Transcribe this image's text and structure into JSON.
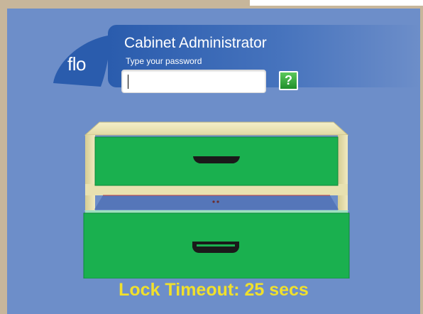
{
  "logo": {
    "text": "flo",
    "icon": "flo-logo-icon",
    "color": "#2a5cad"
  },
  "login": {
    "title": "Cabinet Administrator",
    "subtitle": "Type your password",
    "password_value": "",
    "help_label": "?"
  },
  "cabinet": {
    "icon": "filing-cabinet-icon",
    "drawer_color": "#1ab04f",
    "frame_color": "#ece6b5",
    "handle_color": "#1a1a1a",
    "drawers": [
      {
        "name": "top-drawer",
        "state": "closed"
      },
      {
        "name": "bottom-drawer",
        "state": "open"
      }
    ]
  },
  "status": {
    "lock_timeout": "Lock Timeout: 25 secs"
  },
  "colors": {
    "background": "#6d8ec9",
    "frame": "#c7b69b",
    "accent": "#f0e02c",
    "help_button": "#2fa83a"
  }
}
